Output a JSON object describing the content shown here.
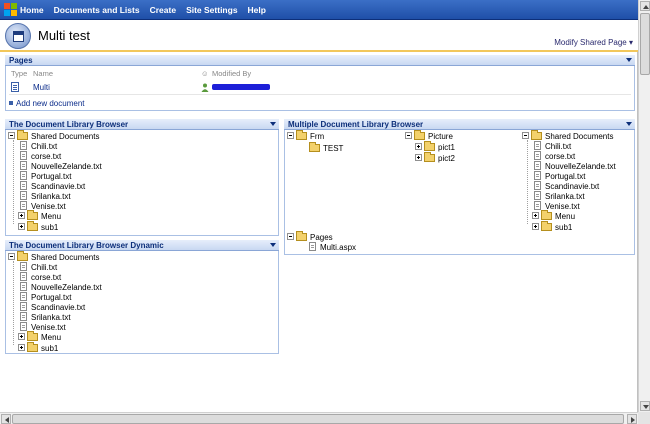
{
  "topnav": {
    "items": [
      "Home",
      "Documents and Lists",
      "Create",
      "Site Settings",
      "Help"
    ]
  },
  "header": {
    "title": "Multi test",
    "modify": "Modify Shared Page ▾"
  },
  "pages": {
    "title": "Pages",
    "col_type": "Type",
    "col_name": "Name",
    "col_modified": "Modified By",
    "row_name": "Multi",
    "add_link": "Add new document"
  },
  "lib1": {
    "title": "The Document Library Browser",
    "root": "Shared Documents",
    "files": [
      "Chili.txt",
      "corse.txt",
      "NouvelleZelande.txt",
      "Portugal.txt",
      "Scandinavie.txt",
      "Srilanka.txt",
      "Venise.txt"
    ],
    "folders": [
      "Menu",
      "sub1"
    ]
  },
  "lib2": {
    "title": "The Document Library Browser Dynamic",
    "root": "Shared Documents",
    "files": [
      "Chili.txt",
      "corse.txt",
      "NouvelleZelande.txt",
      "Portugal.txt",
      "Scandinavie.txt",
      "Srilanka.txt",
      "Venise.txt"
    ],
    "folders": [
      "Menu",
      "sub1"
    ]
  },
  "multi": {
    "title": "Multiple Document Library Browser",
    "frm": {
      "name": "Frm",
      "children": [
        "TEST"
      ]
    },
    "picture": {
      "name": "Picture",
      "children": [
        "pict1",
        "pict2"
      ]
    },
    "shared": {
      "name": "Shared Documents",
      "files": [
        "Chili.txt",
        "corse.txt",
        "NouvelleZelande.txt",
        "Portugal.txt",
        "Scandinavie.txt",
        "Srilanka.txt",
        "Venise.txt"
      ],
      "folders": [
        "Menu",
        "sub1"
      ]
    },
    "pages": {
      "name": "Pages",
      "children": [
        "Multi.aspx"
      ]
    }
  },
  "colors": {
    "nav": "#2a5bb5",
    "accent": "#f2c75b",
    "wp_title": "#0d2f7a"
  }
}
